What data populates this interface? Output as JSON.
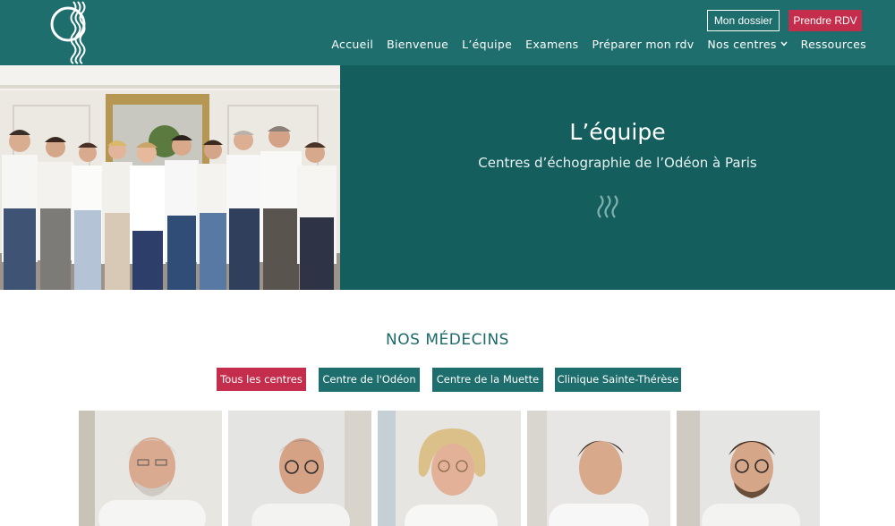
{
  "header": {
    "logo_icon": "waves-circle-logo-icon",
    "buttons": {
      "dossier": "Mon dossier",
      "rdv": "Prendre RDV"
    },
    "nav": [
      {
        "label": "Accueil"
      },
      {
        "label": "Bienvenue"
      },
      {
        "label": "L’équipe"
      },
      {
        "label": "Examens"
      },
      {
        "label": "Préparer mon rdv"
      },
      {
        "label": "Nos centres",
        "icon": "chevron-down-icon"
      },
      {
        "label": "Ressources"
      }
    ]
  },
  "hero": {
    "title": "L’équipe",
    "subtitle": "Centres d’échographie de l’Odéon à Paris",
    "waves_icon": "waves-icon"
  },
  "doctors": {
    "title": "NOS MÉDECINS",
    "filters": [
      "Tous les centres",
      "Centre de l'Odéon",
      "Centre de la Muette",
      "Clinique Sainte-Thérèse"
    ]
  },
  "colors": {
    "primary_teal": "#1d6e6d",
    "hero_teal": "#145f5e",
    "accent_red": "#c52d4c",
    "title_teal": "#1b6a69"
  }
}
